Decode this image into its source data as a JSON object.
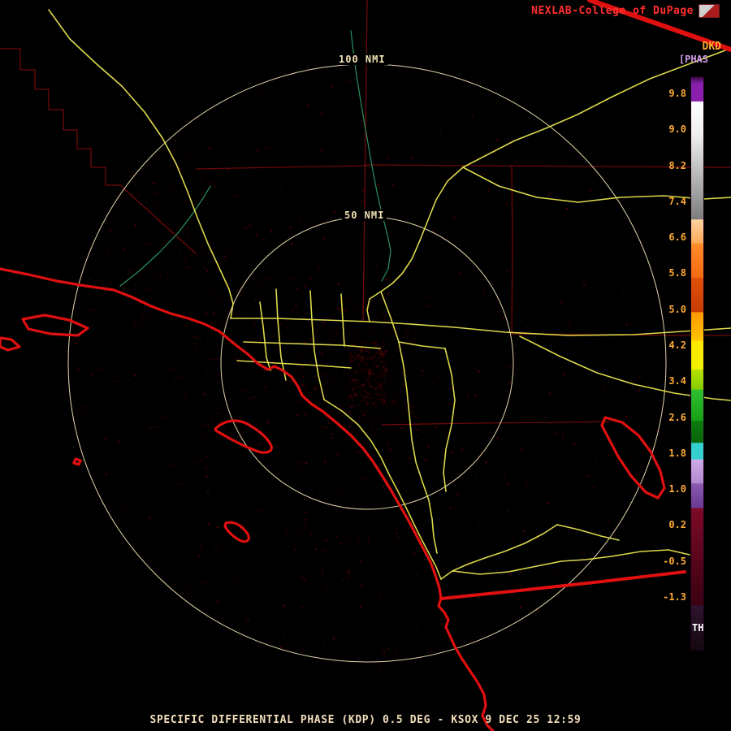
{
  "header": {
    "brand": "NEXLAB-College of DuPage"
  },
  "rings": {
    "outer_label": "100 NMI",
    "inner_label": "50 NMI"
  },
  "colorbar": {
    "product_code": "DKD",
    "units_label": "[PHAS",
    "threshold_label": "TH",
    "ticks": [
      "9.8",
      "9.0",
      "8.2",
      "7.4",
      "6.6",
      "5.8",
      "5.0",
      "4.2",
      "3.4",
      "2.6",
      "1.8",
      "1.0",
      "0.2",
      "-0.5",
      "-1.3"
    ],
    "segments": [
      {
        "p": 0.0,
        "c": "#3a0a46"
      },
      {
        "p": 0.012,
        "c": "#8a1fae"
      },
      {
        "p": 0.042,
        "c": "#8a1fae"
      },
      {
        "p": 0.043,
        "c": "#ffffff"
      },
      {
        "p": 0.1,
        "c": "#efefef"
      },
      {
        "p": 0.248,
        "c": "#7d7d7d"
      },
      {
        "p": 0.249,
        "c": "#ffd2a0"
      },
      {
        "p": 0.29,
        "c": "#ffab57"
      },
      {
        "p": 0.291,
        "c": "#ff8c2a"
      },
      {
        "p": 0.35,
        "c": "#f26a12"
      },
      {
        "p": 0.351,
        "c": "#e05008"
      },
      {
        "p": 0.41,
        "c": "#c83c00"
      },
      {
        "p": 0.411,
        "c": "#ff9a00"
      },
      {
        "p": 0.46,
        "c": "#ffc400"
      },
      {
        "p": 0.461,
        "c": "#ffe800"
      },
      {
        "p": 0.51,
        "c": "#f0f000"
      },
      {
        "p": 0.511,
        "c": "#b8e000"
      },
      {
        "p": 0.545,
        "c": "#84cc00"
      },
      {
        "p": 0.546,
        "c": "#2fbf2f"
      },
      {
        "p": 0.6,
        "c": "#16a016"
      },
      {
        "p": 0.601,
        "c": "#0c7a0c"
      },
      {
        "p": 0.638,
        "c": "#0a660a"
      },
      {
        "p": 0.639,
        "c": "#35cfcf"
      },
      {
        "p": 0.667,
        "c": "#35cfcf"
      },
      {
        "p": 0.668,
        "c": "#cfaae8"
      },
      {
        "p": 0.709,
        "c": "#b08ad0"
      },
      {
        "p": 0.71,
        "c": "#8a5ab2"
      },
      {
        "p": 0.752,
        "c": "#6a3a92"
      },
      {
        "p": 0.753,
        "c": "#7c0a28"
      },
      {
        "p": 0.85,
        "c": "#56041a"
      },
      {
        "p": 0.922,
        "c": "#3a0212"
      },
      {
        "p": 0.923,
        "c": "#2e1430"
      },
      {
        "p": 1.0,
        "c": "#15080f"
      }
    ]
  },
  "footer": {
    "status": "SPECIFIC DIFFERENTIAL PHASE (KDP) 0.5 DEG - KSOX 9 DEC 25 12:59"
  },
  "colors": {
    "brand": "#ff2f2f",
    "ring": "#f0e2b4",
    "road": "#e8e44e",
    "river": "#2fa06a",
    "border": "#7a0a0a",
    "coast": "#e01010",
    "tick": "#ffaa33",
    "units": "#cf9fe8",
    "status": "#f2debc",
    "echo": "#6b0000"
  }
}
